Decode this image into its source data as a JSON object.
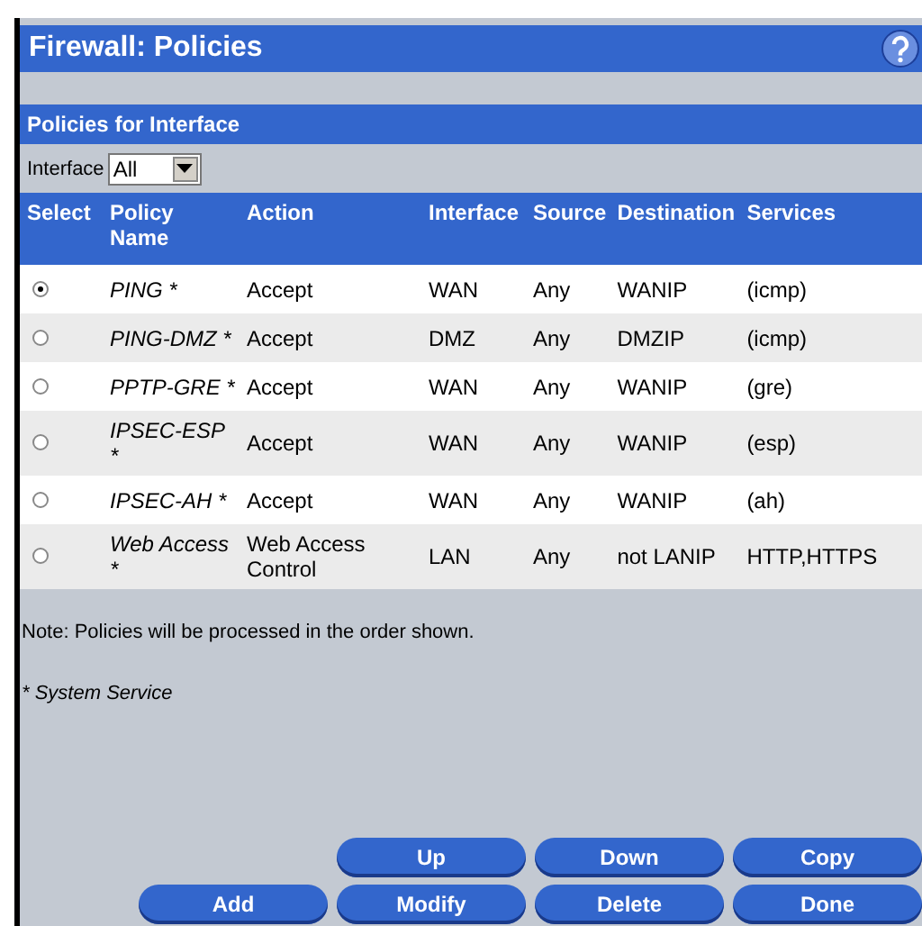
{
  "title": "Firewall: Policies",
  "section": "Policies for Interface",
  "filter": {
    "label": "Interface",
    "value": "All"
  },
  "columns": [
    "Select",
    "Policy Name",
    "Action",
    "Interface",
    "Source",
    "Destination",
    "Services"
  ],
  "rows": [
    {
      "selected": true,
      "name": "PING *",
      "action": "Accept",
      "interface": "WAN",
      "source": "Any",
      "destination": "WANIP",
      "services": "(icmp)"
    },
    {
      "selected": false,
      "name": "PING-DMZ *",
      "action": "Accept",
      "interface": "DMZ",
      "source": "Any",
      "destination": "DMZIP",
      "services": "(icmp)"
    },
    {
      "selected": false,
      "name": "PPTP-GRE *",
      "action": "Accept",
      "interface": "WAN",
      "source": "Any",
      "destination": "WANIP",
      "services": "(gre)"
    },
    {
      "selected": false,
      "name": "IPSEC-ESP *",
      "action": "Accept",
      "interface": "WAN",
      "source": "Any",
      "destination": "WANIP",
      "services": "(esp)"
    },
    {
      "selected": false,
      "name": "IPSEC-AH *",
      "action": "Accept",
      "interface": "WAN",
      "source": "Any",
      "destination": "WANIP",
      "services": "(ah)"
    },
    {
      "selected": false,
      "name": "Web Access *",
      "action": "Web Access Control",
      "interface": "LAN",
      "source": "Any",
      "destination": "not LANIP",
      "services": "HTTP,HTTPS"
    }
  ],
  "note": "Note: Policies will be processed in the order shown.",
  "legend": "* System Service",
  "button_rows": [
    [
      "Up",
      "Down",
      "Copy"
    ],
    [
      "Add",
      "Modify",
      "Delete",
      "Done"
    ]
  ]
}
